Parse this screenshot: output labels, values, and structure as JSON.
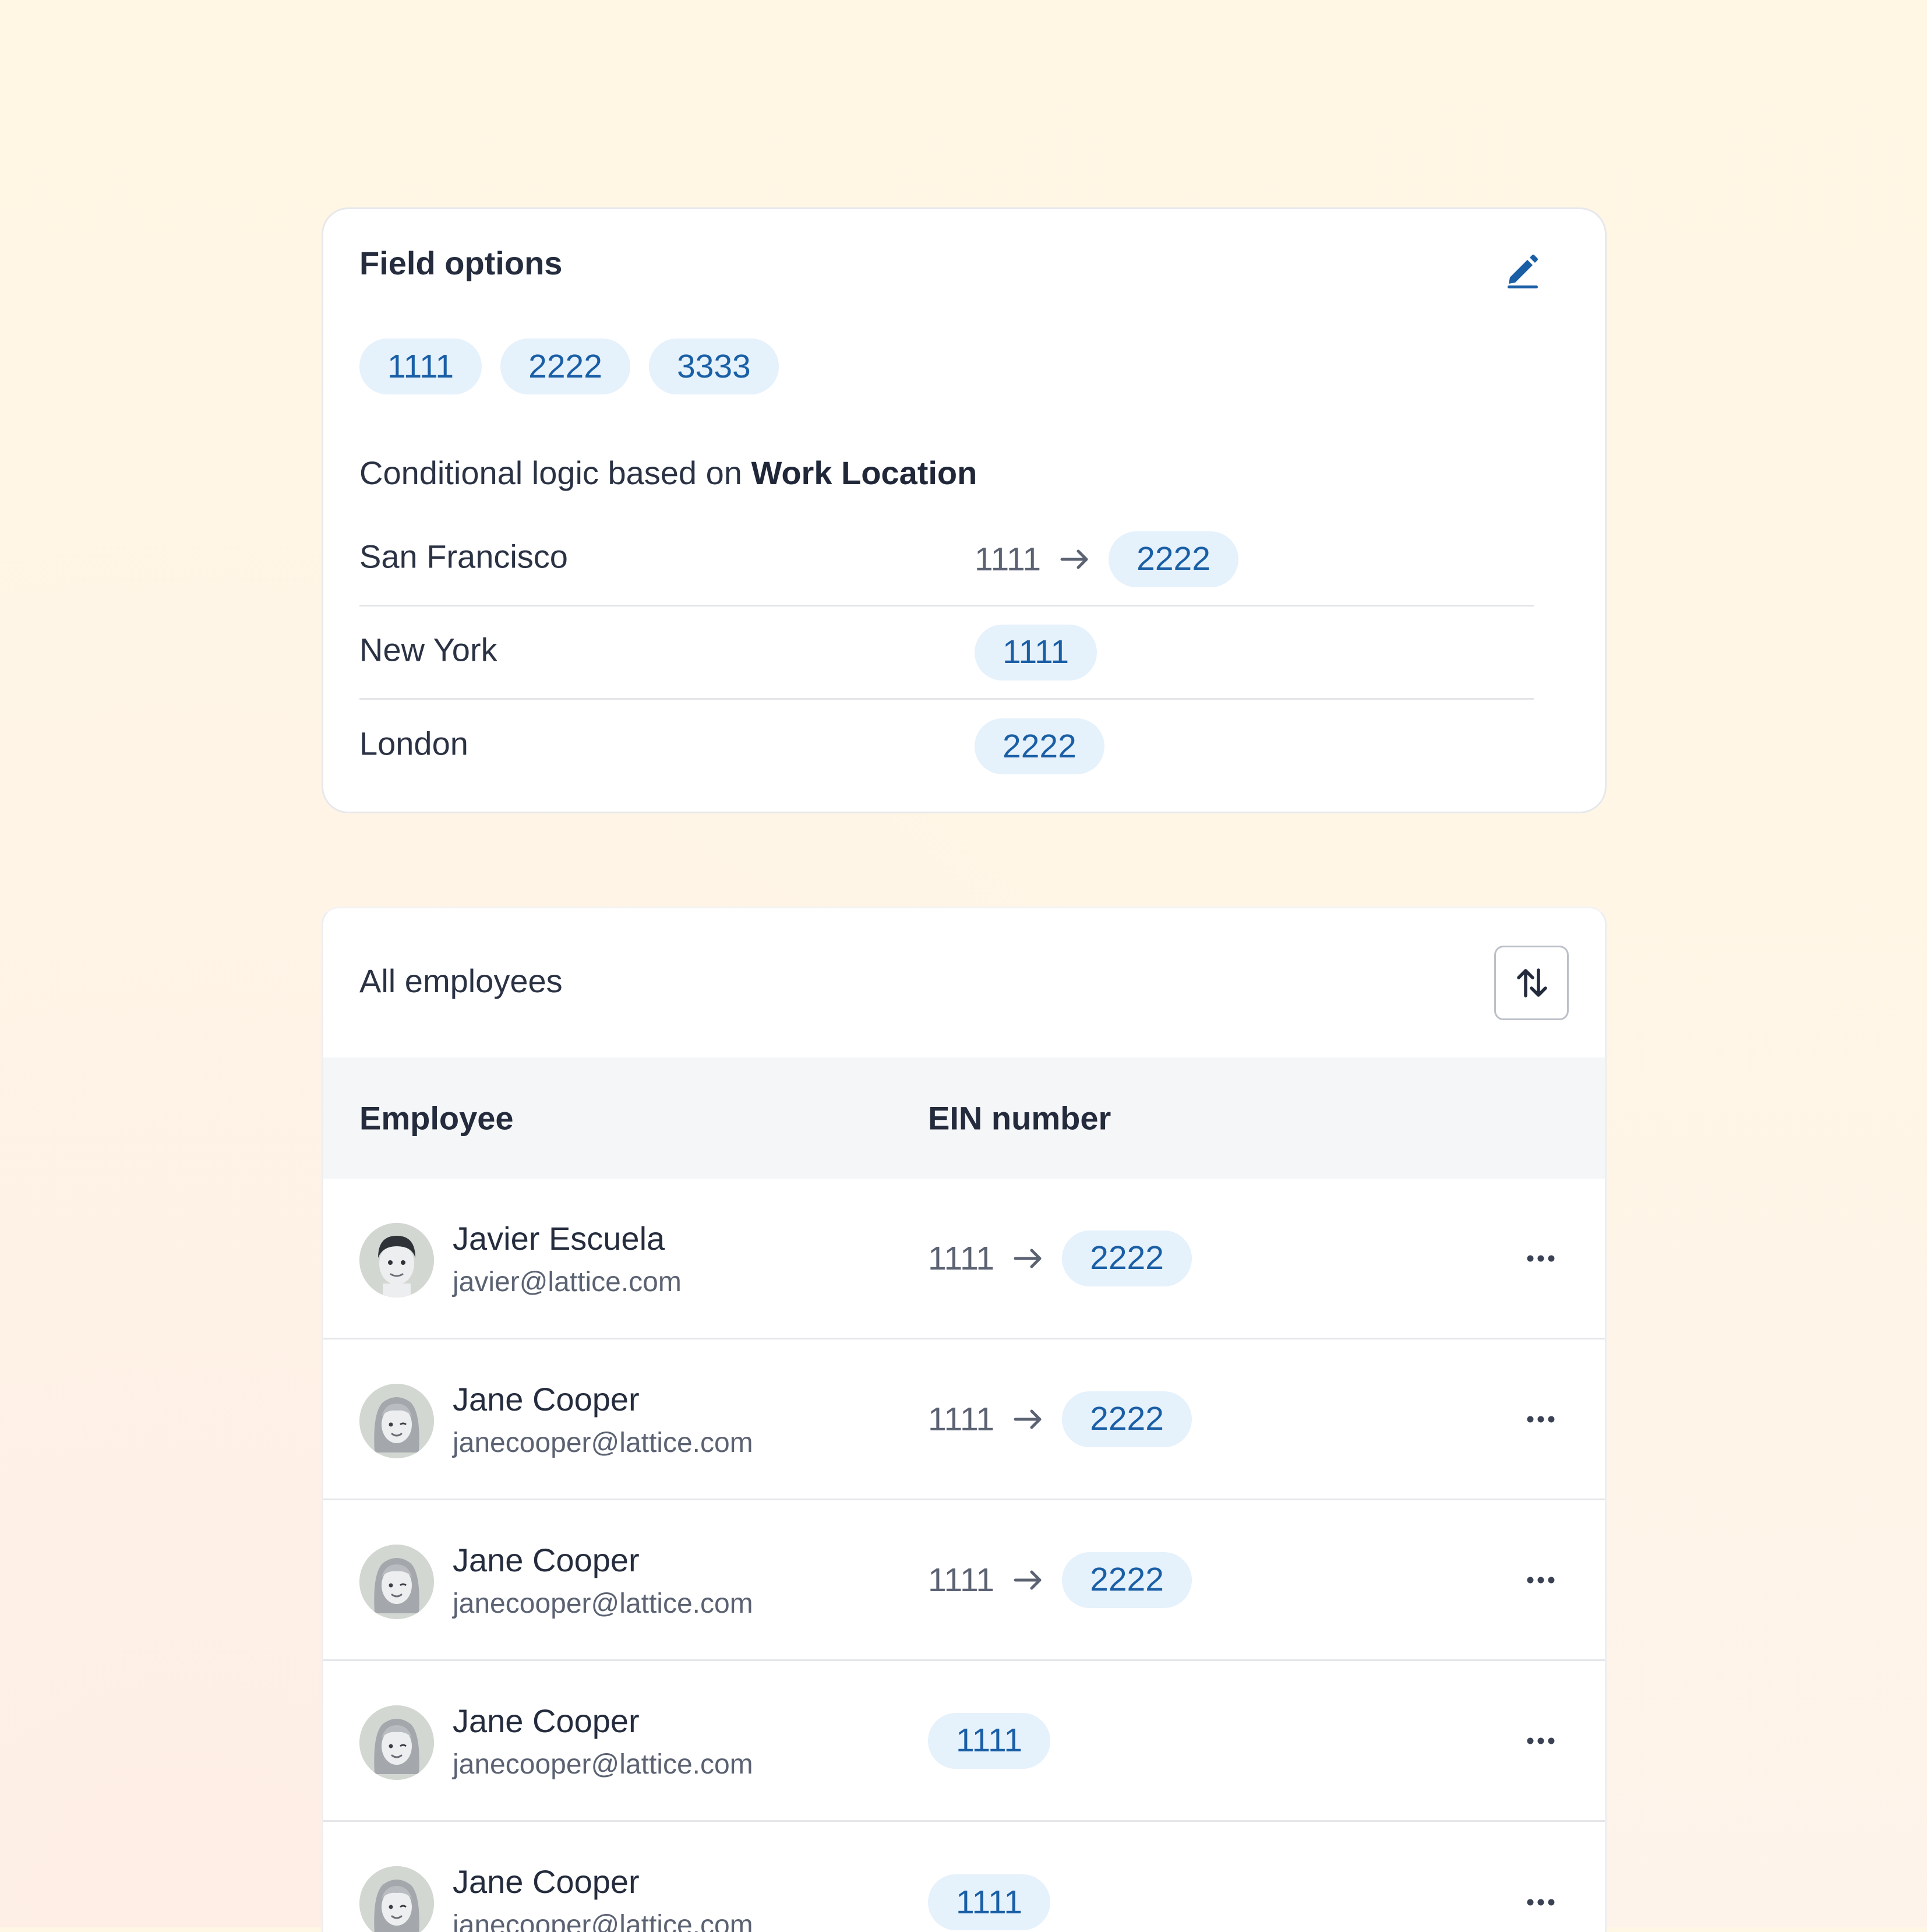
{
  "field_options": {
    "title": "Field options",
    "edit_icon": "pencil-icon",
    "options": [
      "1111",
      "2222",
      "3333"
    ],
    "conditional_prefix": "Conditional logic based on ",
    "conditional_field": "Work Location",
    "rules": [
      {
        "city": "San Francisco",
        "old_value": "1111",
        "new_value": "2222"
      },
      {
        "city": "New York",
        "new_value": "1111"
      },
      {
        "city": "London",
        "new_value": "2222"
      }
    ]
  },
  "employees": {
    "title": "All employees",
    "sort_icon": "sort-arrows-icon",
    "columns": {
      "employee": "Employee",
      "ein": "EIN number"
    },
    "rows": [
      {
        "name": "Javier Escuela",
        "email": "javier@lattice.com",
        "old_value": "1111",
        "new_value": "2222",
        "avatar": "male"
      },
      {
        "name": "Jane Cooper",
        "email": "janecooper@lattice.com",
        "old_value": "1111",
        "new_value": "2222",
        "avatar": "female"
      },
      {
        "name": "Jane Cooper",
        "email": "janecooper@lattice.com",
        "old_value": "1111",
        "new_value": "2222",
        "avatar": "female"
      },
      {
        "name": "Jane Cooper",
        "email": "janecooper@lattice.com",
        "new_value": "1111",
        "avatar": "female"
      },
      {
        "name": "Jane Cooper",
        "email": "janecooper@lattice.com",
        "new_value": "1111",
        "avatar": "female"
      }
    ]
  },
  "colors": {
    "pill_bg": "#e5f1fb",
    "pill_text": "#1a5fa6",
    "accent": "#1a5fa6",
    "text": "#212b3f",
    "muted": "#5b6272"
  }
}
